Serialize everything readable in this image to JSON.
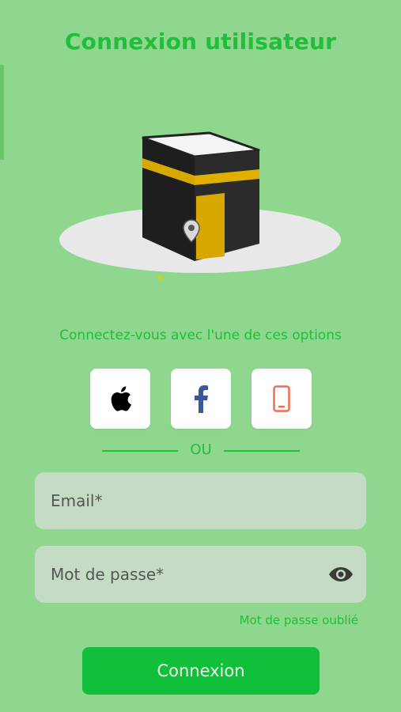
{
  "header": {
    "title": "Connexion utilisateur"
  },
  "illustration": {
    "name": "kaaba-illustration"
  },
  "social": {
    "prompt": "Connectez-vous avec l'une de ces options",
    "buttons": [
      {
        "name": "apple",
        "icon": "apple-icon"
      },
      {
        "name": "facebook",
        "icon": "facebook-icon",
        "color": "#3b5998"
      },
      {
        "name": "phone",
        "icon": "phone-icon",
        "color": "#f26b4f"
      }
    ]
  },
  "separator": {
    "label": "OU"
  },
  "form": {
    "email_placeholder": "Email*",
    "password_placeholder": "Mot de passe*",
    "forgot_label": "Mot de passe oublié",
    "submit_label": "Connexion"
  },
  "colors": {
    "background": "#8fd68f",
    "accent": "#1fbf3a",
    "button": "#12bf3a",
    "field": "#c4dcc4"
  }
}
